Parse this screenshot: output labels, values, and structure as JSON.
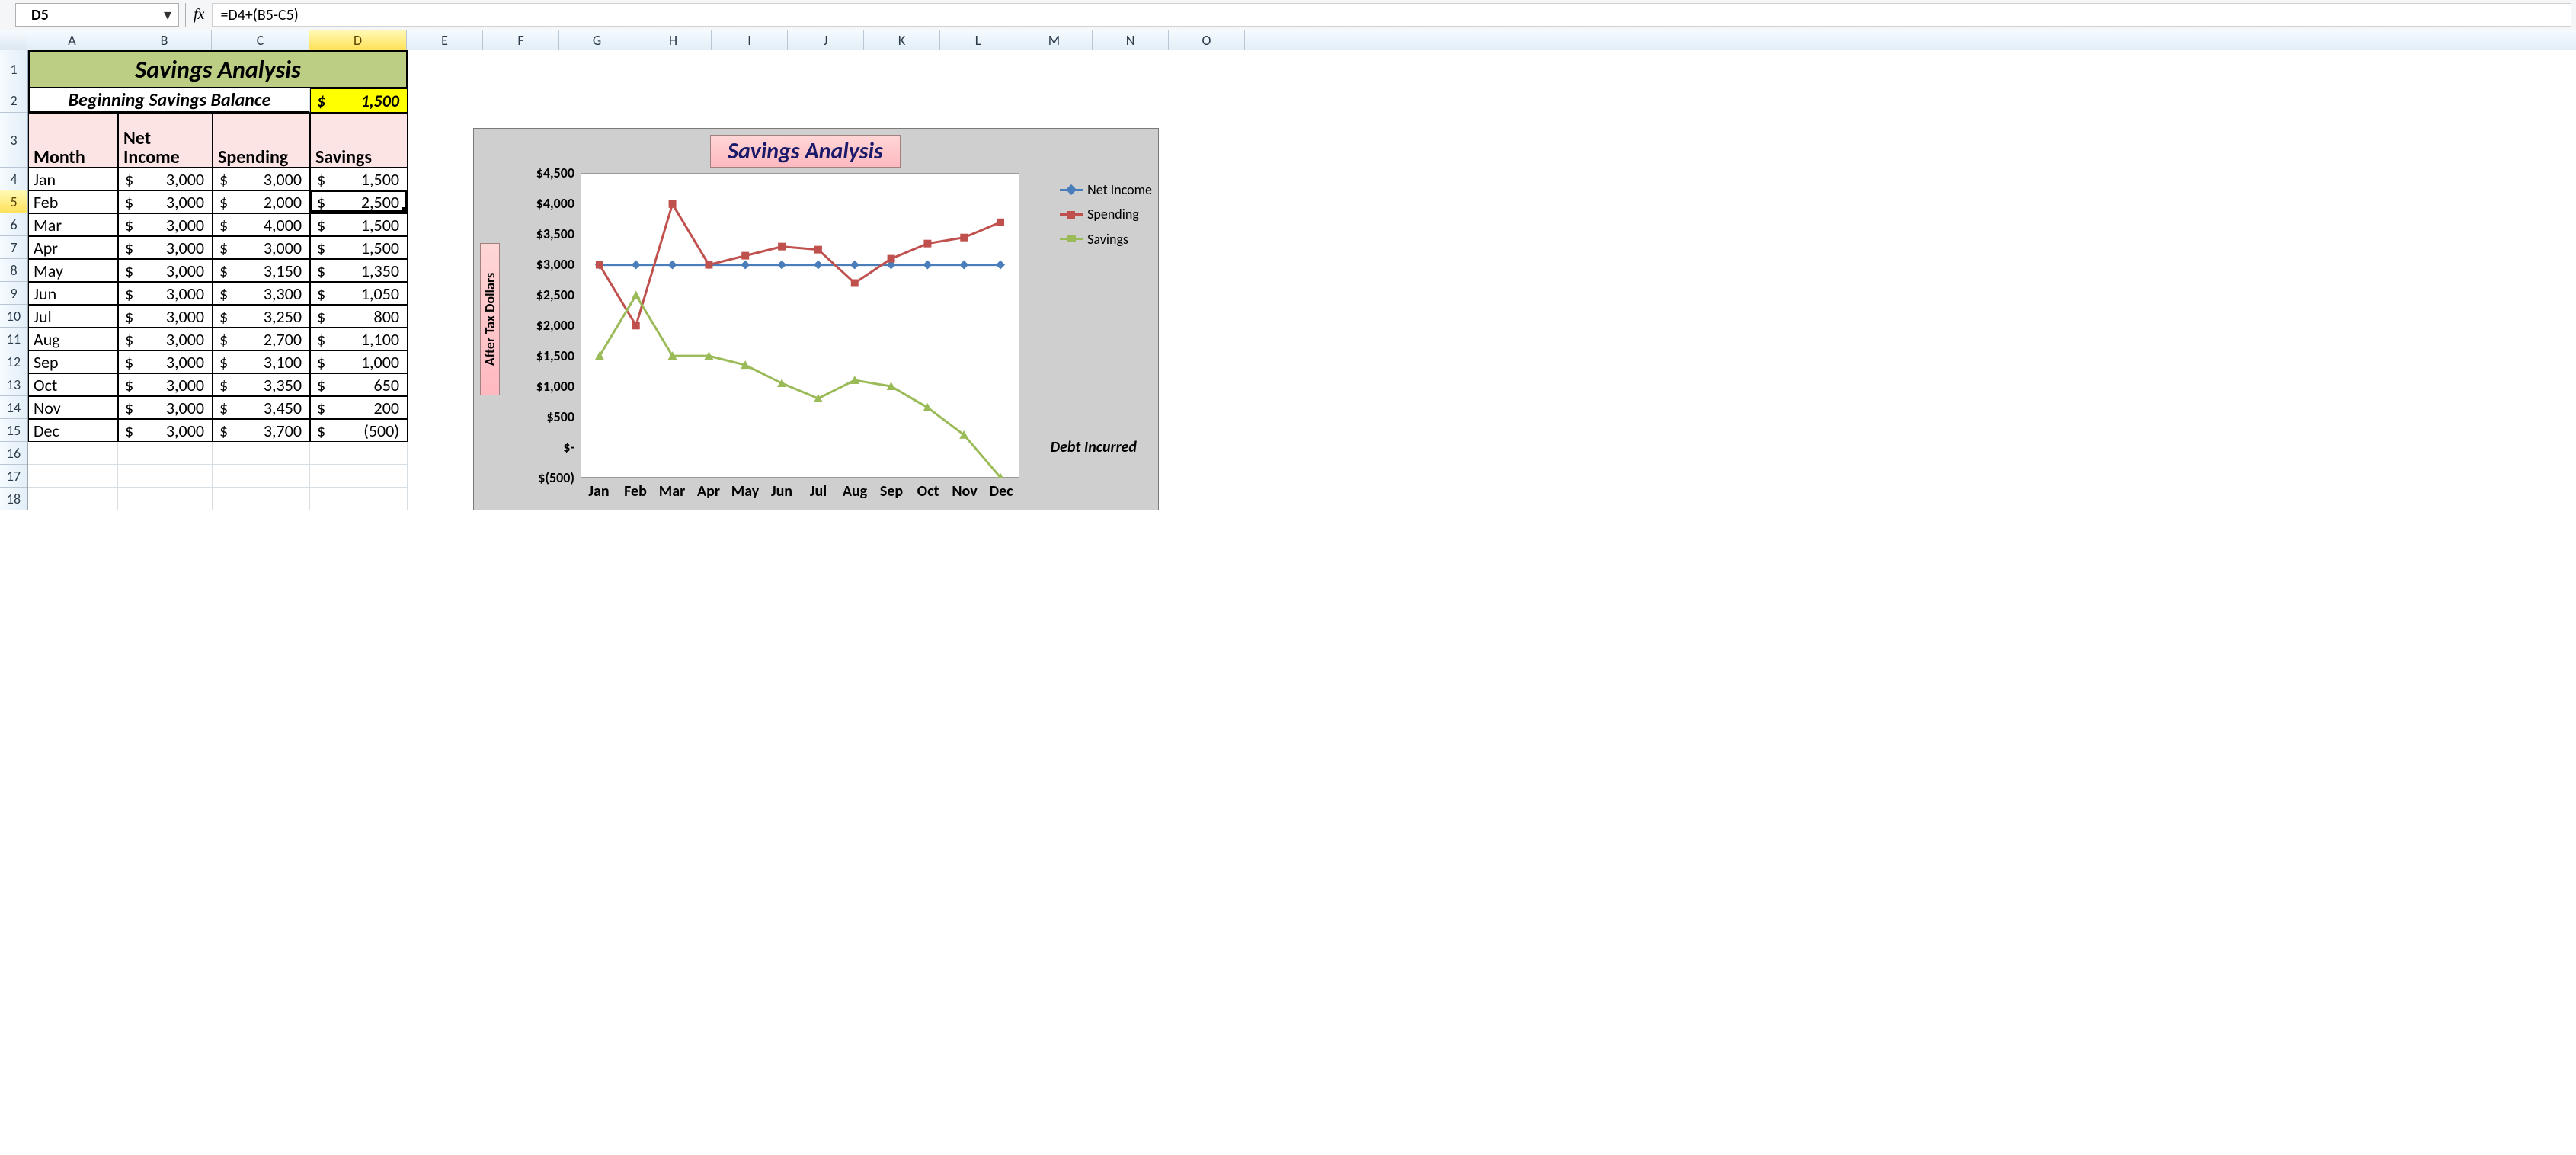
{
  "formula_bar": {
    "name_box": "D5",
    "fx_label": "fx",
    "formula": "=D4+(B5-C5)"
  },
  "columns": [
    "A",
    "B",
    "C",
    "D",
    "E",
    "F",
    "G",
    "H",
    "I",
    "J",
    "K",
    "L",
    "M",
    "N",
    "O"
  ],
  "active_column": "D",
  "row_headers": [
    1,
    2,
    3,
    4,
    5,
    6,
    7,
    8,
    9,
    10,
    11,
    12,
    13,
    14,
    15,
    16,
    17,
    18
  ],
  "active_row": 5,
  "sheet": {
    "title": "Savings Analysis",
    "beginning_label": "Beginning Savings Balance",
    "beginning_value": "1,500",
    "currency": "$",
    "headers": {
      "month": "Month",
      "net": "Net Income",
      "spend": "Spending",
      "save": "Savings"
    },
    "rows": [
      {
        "month": "Jan",
        "net": "3,000",
        "spend": "3,000",
        "save": "1,500"
      },
      {
        "month": "Feb",
        "net": "3,000",
        "spend": "2,000",
        "save": "2,500"
      },
      {
        "month": "Mar",
        "net": "3,000",
        "spend": "4,000",
        "save": "1,500"
      },
      {
        "month": "Apr",
        "net": "3,000",
        "spend": "3,000",
        "save": "1,500"
      },
      {
        "month": "May",
        "net": "3,000",
        "spend": "3,150",
        "save": "1,350"
      },
      {
        "month": "Jun",
        "net": "3,000",
        "spend": "3,300",
        "save": "1,050"
      },
      {
        "month": "Jul",
        "net": "3,000",
        "spend": "3,250",
        "save": "800"
      },
      {
        "month": "Aug",
        "net": "3,000",
        "spend": "2,700",
        "save": "1,100"
      },
      {
        "month": "Sep",
        "net": "3,000",
        "spend": "3,100",
        "save": "1,000"
      },
      {
        "month": "Oct",
        "net": "3,000",
        "spend": "3,350",
        "save": "650"
      },
      {
        "month": "Nov",
        "net": "3,000",
        "spend": "3,450",
        "save": "200"
      },
      {
        "month": "Dec",
        "net": "3,000",
        "spend": "3,700",
        "save": "(500)"
      }
    ]
  },
  "chart_data": {
    "type": "line",
    "title": "Savings Analysis",
    "ylabel": "After Tax Dollars",
    "annotation": "Debt Incurred",
    "ylim": [
      -500,
      4500
    ],
    "y_ticks": [
      "$4,500",
      "$4,000",
      "$3,500",
      "$3,000",
      "$2,500",
      "$2,000",
      "$1,500",
      "$1,000",
      "$500",
      "$-",
      "$(500)"
    ],
    "categories": [
      "Jan",
      "Feb",
      "Mar",
      "Apr",
      "May",
      "Jun",
      "Jul",
      "Aug",
      "Sep",
      "Oct",
      "Nov",
      "Dec"
    ],
    "series": [
      {
        "name": "Net Income",
        "values": [
          3000,
          3000,
          3000,
          3000,
          3000,
          3000,
          3000,
          3000,
          3000,
          3000,
          3000,
          3000
        ]
      },
      {
        "name": "Spending",
        "values": [
          3000,
          2000,
          4000,
          3000,
          3150,
          3300,
          3250,
          2700,
          3100,
          3350,
          3450,
          3700
        ]
      },
      {
        "name": "Savings",
        "values": [
          1500,
          2500,
          1500,
          1500,
          1350,
          1050,
          800,
          1100,
          1000,
          650,
          200,
          -500
        ]
      }
    ],
    "legend": [
      "Net Income",
      "Spending",
      "Savings"
    ]
  }
}
